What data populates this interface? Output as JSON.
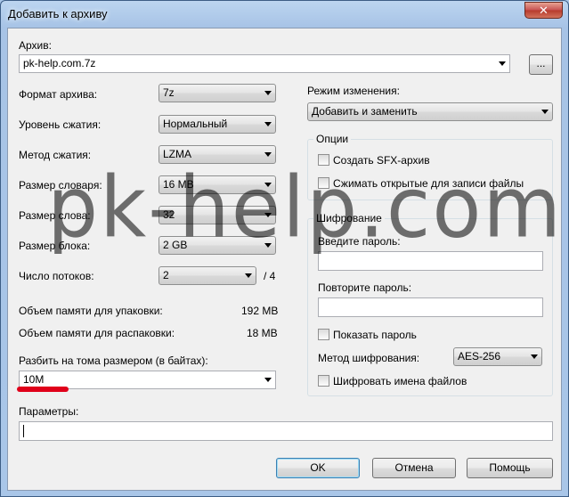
{
  "window": {
    "title": "Добавить к архиву",
    "close_glyph": "✕"
  },
  "archive": {
    "label": "Архив:",
    "value": "pk-help.com.7z",
    "browse_label": "..."
  },
  "left": {
    "format_label": "Формат архива:",
    "format_value": "7z",
    "level_label": "Уровень сжатия:",
    "level_value": "Нормальный",
    "method_label": "Метод сжатия:",
    "method_value": "LZMA",
    "dict_label": "Размер словаря:",
    "dict_value": "16 MB",
    "word_label": "Размер слова:",
    "word_value": "32",
    "block_label": "Размер блока:",
    "block_value": "2 GB",
    "threads_label": "Число потоков:",
    "threads_value": "2",
    "threads_max": "/ 4",
    "mem_pack_label": "Объем памяти для упаковки:",
    "mem_pack_value": "192 MB",
    "mem_unpack_label": "Объем памяти для распаковки:",
    "mem_unpack_value": "18 MB",
    "split_label": "Разбить на тома размером (в байтах):",
    "split_value": "10M"
  },
  "params": {
    "label": "Параметры:",
    "value": ""
  },
  "right": {
    "mode_label": "Режим изменения:",
    "mode_value": "Добавить и заменить",
    "options_title": "Опции",
    "sfx_label": "Создать SFX-архив",
    "shared_label": "Сжимать открытые для записи файлы",
    "encryption_title": "Шифрование",
    "password_label": "Введите пароль:",
    "repeat_label": "Повторите пароль:",
    "show_password_label": "Показать пароль",
    "enc_method_label": "Метод шифрования:",
    "enc_method_value": "AES-256",
    "encrypt_names_label": "Шифровать имена файлов"
  },
  "buttons": {
    "ok": "OK",
    "cancel": "Отмена",
    "help": "Помощь"
  },
  "watermark": "pk-help.com",
  "colors": {
    "accent_underline": "#e0001a",
    "close_button": "#c75050"
  }
}
